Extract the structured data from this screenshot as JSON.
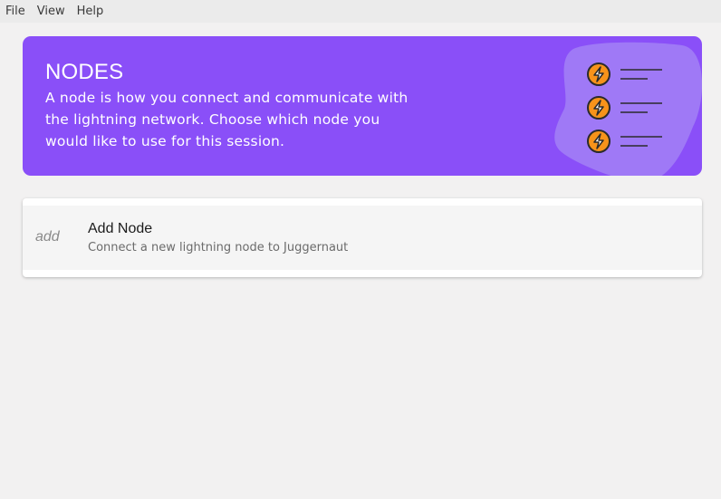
{
  "menubar": {
    "items": [
      {
        "label": "File"
      },
      {
        "label": "View"
      },
      {
        "label": "Help"
      }
    ]
  },
  "banner": {
    "title": "NODES",
    "description": "A node is how you connect and communicate with the lightning network. Choose which node you would like to use for this session.",
    "background_color": "#8a4ff8",
    "illustration_icon": "lightning-list-illustration"
  },
  "node_list": {
    "add_node": {
      "icon": "add",
      "title": "Add Node",
      "subtitle": "Connect a new lightning node to Juggernaut"
    }
  }
}
